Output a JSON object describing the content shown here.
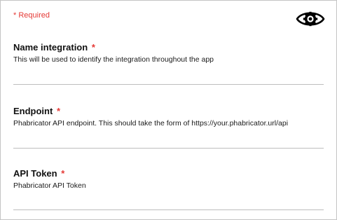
{
  "form": {
    "required_note": "* Required",
    "visibility_toggle_icon": "eye-icon",
    "fields": [
      {
        "label": "Name integration",
        "required_mark": "*",
        "help": "This will be used to identify the integration throughout the app",
        "value": ""
      },
      {
        "label": "Endpoint",
        "required_mark": "*",
        "help": "Phabricator API endpoint. This should take the form of https://your.phabricator.url/api",
        "value": ""
      },
      {
        "label": "API Token",
        "required_mark": "*",
        "help": "Phabricator API Token",
        "value": ""
      }
    ]
  },
  "colors": {
    "required": "#e53935",
    "text": "#111111",
    "border": "#c4c4c4",
    "underline": "#bdbdbd"
  }
}
